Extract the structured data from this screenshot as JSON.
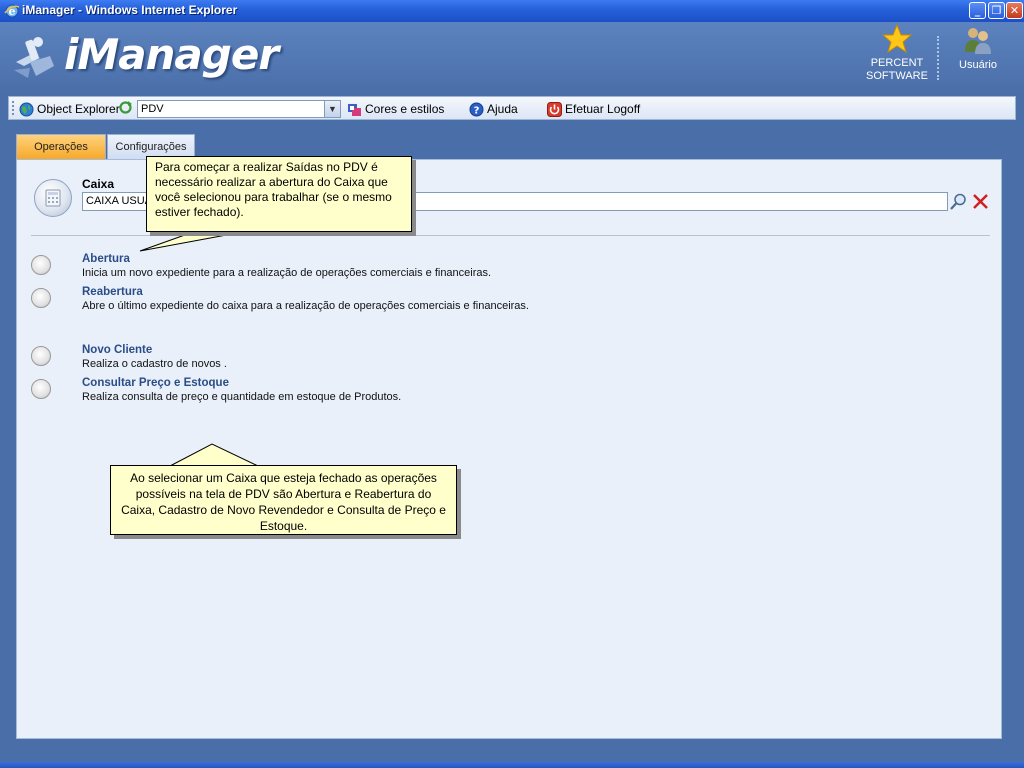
{
  "window": {
    "title": "iManager - Windows Internet Explorer",
    "buttons": [
      "_",
      "❐",
      "✕"
    ]
  },
  "header": {
    "logo_text": "iManager",
    "percent_label_1": "PERCENT",
    "percent_label_2": "SOFTWARE",
    "usuario_label": "Usuário"
  },
  "toolbar": {
    "object_explorer": "Object Explorer",
    "pdv_value": "PDV",
    "cores_estilos": "Cores e estilos",
    "ajuda": "Ajuda",
    "logoff": "Efetuar Logoff"
  },
  "tabs": [
    {
      "label": "Operações",
      "active": true
    },
    {
      "label": "Configurações",
      "active": false
    }
  ],
  "caixa": {
    "label": "Caixa",
    "value": "CAIXA USUÁ"
  },
  "operations": [
    {
      "title": "Abertura",
      "description": "Inicia um novo expediente para a realização de operações comerciais e financeiras."
    },
    {
      "title": "Reabertura",
      "description": "Abre o último expediente do caixa para a realização de operações comerciais e financeiras."
    },
    {
      "title": "Novo  Cliente",
      "description": "Realiza o cadastro de novos ."
    },
    {
      "title": "Consultar Preço e Estoque",
      "description": "Realiza consulta de preço e quantidade em estoque de Produtos."
    }
  ],
  "callouts": {
    "top": "Para começar a realizar Saídas no PDV é necessário realizar a abertura do Caixa que você selecionou para trabalhar (se o mesmo estiver fechado).",
    "bottom": "Ao selecionar um Caixa que esteja fechado as operações possíveis na tela de PDV são Abertura e Reabertura do Caixa, Cadastro de Novo Revendedor e Consulta de Preço e Estoque."
  },
  "colors": {
    "accent_orange": "#f6a726",
    "title_blue": "#2a4d88",
    "callout_bg": "#ffffcc"
  }
}
